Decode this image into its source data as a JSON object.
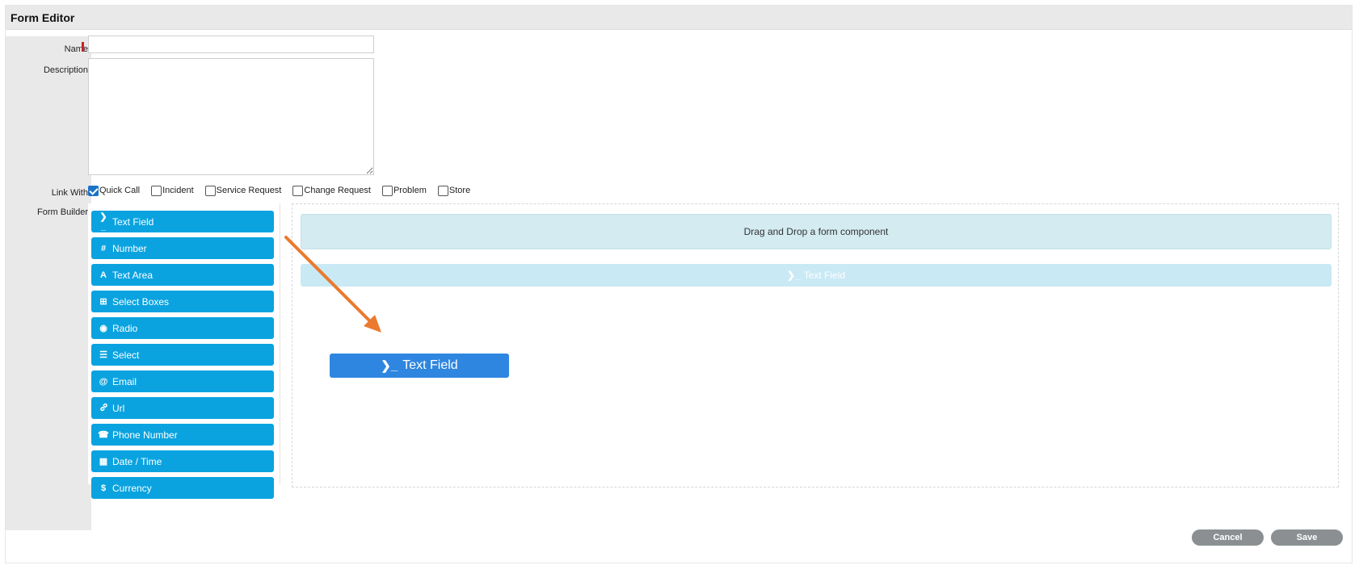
{
  "window": {
    "title": "Form Editor"
  },
  "form": {
    "name_label": "Name",
    "name_value": "",
    "description_label": "Description",
    "description_value": "",
    "link_with_label": "Link With",
    "link_options": [
      {
        "label": "Quick Call",
        "checked": true
      },
      {
        "label": "Incident",
        "checked": false
      },
      {
        "label": "Service Request",
        "checked": false
      },
      {
        "label": "Change Request",
        "checked": false
      },
      {
        "label": "Problem",
        "checked": false
      },
      {
        "label": "Store",
        "checked": false
      }
    ],
    "form_builder_label": "Form Builder"
  },
  "palette": {
    "components": [
      {
        "label": "Text Field",
        "icon": "terminal-icon",
        "glyph": "❯_"
      },
      {
        "label": "Number",
        "icon": "hash-icon",
        "glyph": "#"
      },
      {
        "label": "Text Area",
        "icon": "font-icon",
        "glyph": "A"
      },
      {
        "label": "Select Boxes",
        "icon": "plus-square-icon",
        "glyph": "⊞"
      },
      {
        "label": "Radio",
        "icon": "dot-circle-icon",
        "glyph": "◉"
      },
      {
        "label": "Select",
        "icon": "list-icon",
        "glyph": "☰"
      },
      {
        "label": "Email",
        "icon": "at-icon",
        "glyph": "@"
      },
      {
        "label": "Url",
        "icon": "link-icon",
        "glyph": "🔗"
      },
      {
        "label": "Phone Number",
        "icon": "phone-square-icon",
        "glyph": "☎"
      },
      {
        "label": "Date / Time",
        "icon": "calendar-icon",
        "glyph": "▦"
      },
      {
        "label": "Currency",
        "icon": "dollar-icon",
        "glyph": "$"
      }
    ]
  },
  "builder": {
    "drop_hint": "Drag and Drop a form component",
    "ghost_label": "Text Field",
    "ghost_glyph": "❯_",
    "dragging_label": "Text Field",
    "dragging_glyph": "❯_"
  },
  "buttons": {
    "cancel": "Cancel",
    "save": "Save"
  },
  "colors": {
    "component_blue": "#0aa3e0",
    "drag_blue": "#2e86e0",
    "arrow_orange": "#ea7a2f",
    "button_gray": "#8b8f91"
  }
}
